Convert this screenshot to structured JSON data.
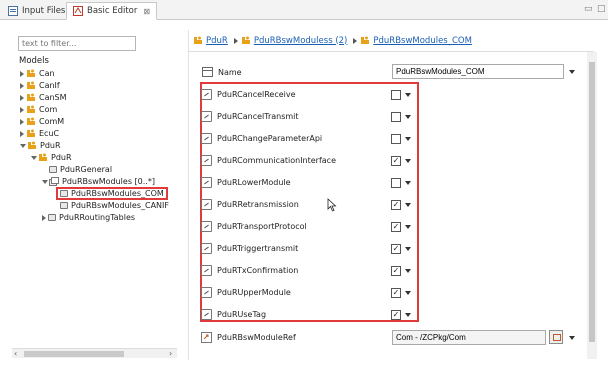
{
  "tabs": [
    {
      "label": "Input Files",
      "icon": "input-files-icon"
    },
    {
      "label": "Basic Editor",
      "icon": "basic-editor-icon",
      "close": "⊠"
    }
  ],
  "window_controls": {
    "minimize": "▭",
    "maximize": "□"
  },
  "left_panel": {
    "filter_placeholder": "text to filter...",
    "models_label": "Models",
    "tree": [
      {
        "label": "Can",
        "expanded": false
      },
      {
        "label": "CanIf",
        "expanded": false
      },
      {
        "label": "CanSM",
        "expanded": false
      },
      {
        "label": "Com",
        "expanded": false
      },
      {
        "label": "ComM",
        "expanded": false
      },
      {
        "label": "EcuC",
        "expanded": false
      },
      {
        "label": "PduR",
        "expanded": true
      },
      {
        "label": "PduR",
        "expanded": true
      },
      {
        "label": "PduRGeneral"
      },
      {
        "label": "PduRBswModules [0..*]",
        "expanded": true
      },
      {
        "label": "PduRBswModules_COM",
        "selected": true
      },
      {
        "label": "PduRBswModules_CANIF"
      },
      {
        "label": "PduRRoutingTables",
        "expanded": false
      }
    ],
    "scroll_left": "‹",
    "scroll_right": "›"
  },
  "breadcrumb": {
    "items": [
      "PduR",
      "PduRBswModuless (2)",
      "PduRBswModules_COM"
    ]
  },
  "form": {
    "name_label": "Name",
    "name_value": "PduRBswModules_COM",
    "params": [
      {
        "label": "PduRCancelReceive",
        "checked": false
      },
      {
        "label": "PduRCancelTransmit",
        "checked": false
      },
      {
        "label": "PduRChangeParameterApi",
        "checked": false
      },
      {
        "label": "PduRCommunicationInterface",
        "checked": true
      },
      {
        "label": "PduRLowerModule",
        "checked": false
      },
      {
        "label": "PduRRetransmission",
        "checked": true
      },
      {
        "label": "PduRTransportProtocol",
        "checked": true
      },
      {
        "label": "PduRTriggertransmit",
        "checked": true
      },
      {
        "label": "PduRTxConfirmation",
        "checked": true
      },
      {
        "label": "PduRUpperModule",
        "checked": true
      },
      {
        "label": "PduRUseTag",
        "checked": true
      }
    ],
    "ref_label": "PduRBswModuleRef",
    "ref_value": "Com - /ZCPkg/Com"
  },
  "colors": {
    "highlight": "#e03a3a",
    "link": "#1a5fb4",
    "module_icon": "#e8a21a"
  }
}
